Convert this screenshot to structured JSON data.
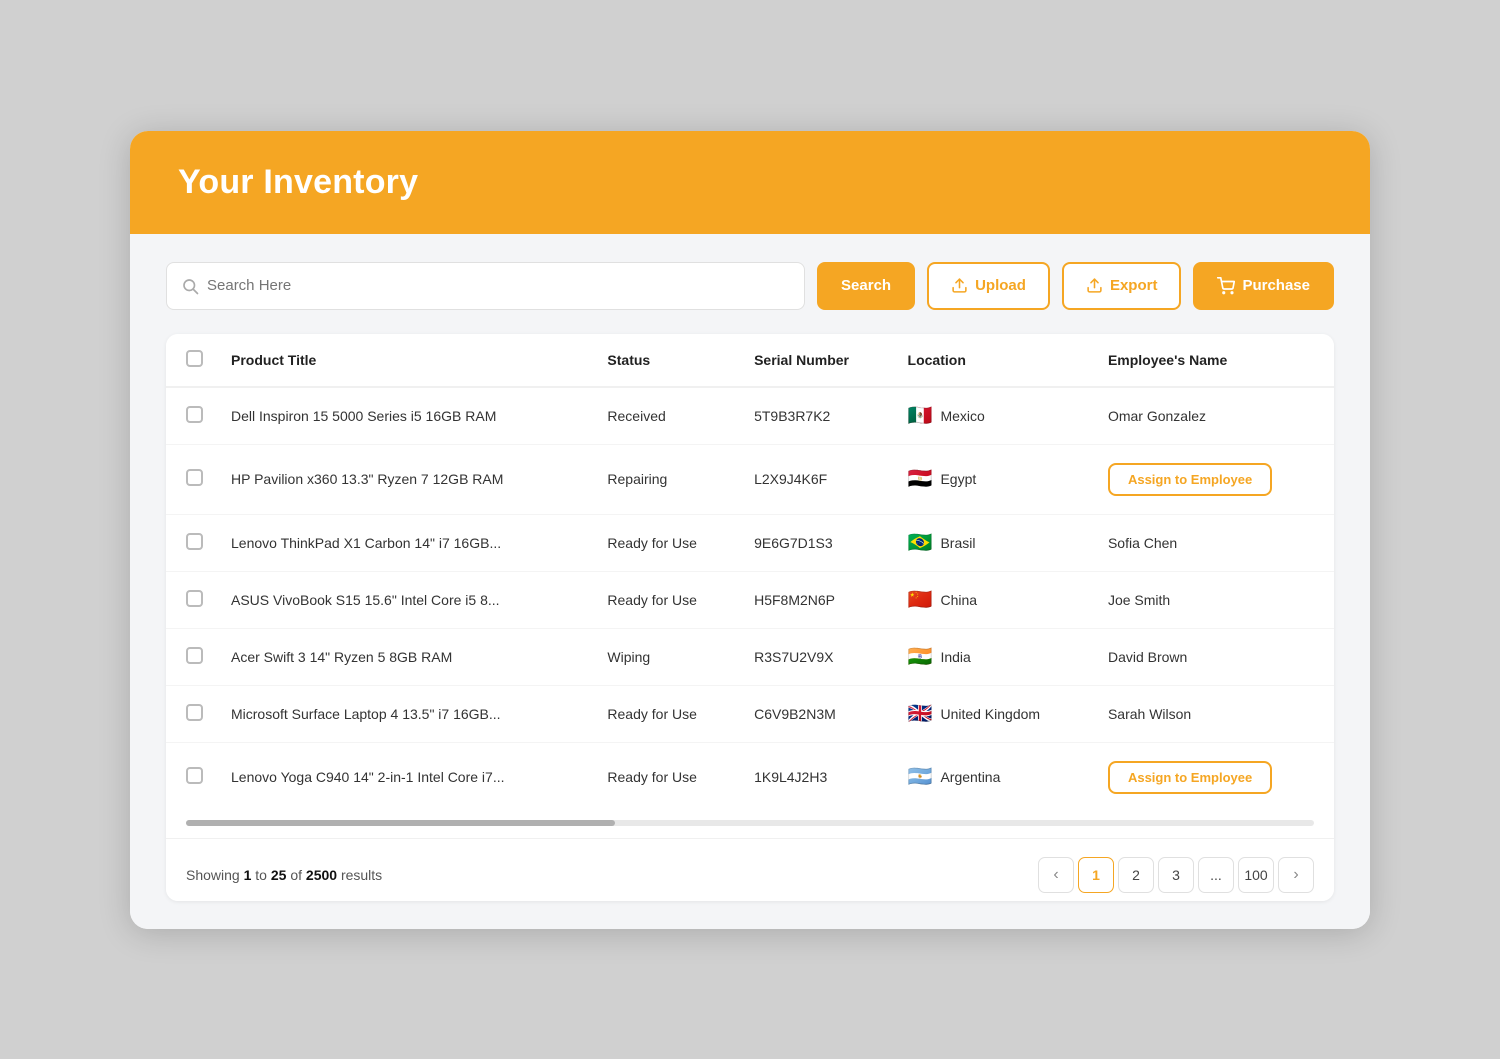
{
  "header": {
    "title": "Your Inventory"
  },
  "toolbar": {
    "search_placeholder": "Search Here",
    "search_label": "Search",
    "upload_label": "Upload",
    "export_label": "Export",
    "purchase_label": "Purchase"
  },
  "table": {
    "columns": [
      "Product Title",
      "Status",
      "Serial Number",
      "Location",
      "Employee's Name"
    ],
    "rows": [
      {
        "product": "Dell Inspiron 15 5000 Series i5 16GB RAM",
        "status": "Received",
        "serial": "5T9B3R7K2",
        "flag": "🇲🇽",
        "location": "Mexico",
        "employee": "Omar Gonzalez",
        "assign": false
      },
      {
        "product": "HP Pavilion x360 13.3\" Ryzen 7 12GB RAM",
        "status": "Repairing",
        "serial": "L2X9J4K6F",
        "flag": "🇪🇬",
        "location": "Egypt",
        "employee": "",
        "assign": true
      },
      {
        "product": "Lenovo ThinkPad X1 Carbon 14\" i7 16GB...",
        "status": "Ready for Use",
        "serial": "9E6G7D1S3",
        "flag": "🇧🇷",
        "location": "Brasil",
        "employee": "Sofia Chen",
        "assign": false
      },
      {
        "product": "ASUS VivoBook S15 15.6\" Intel Core i5 8...",
        "status": "Ready for Use",
        "serial": "H5F8M2N6P",
        "flag": "🇨🇳",
        "location": "China",
        "employee": "Joe Smith",
        "assign": false
      },
      {
        "product": "Acer Swift 3 14\" Ryzen 5 8GB RAM",
        "status": "Wiping",
        "serial": "R3S7U2V9X",
        "flag": "🇮🇳",
        "location": "India",
        "employee": "David Brown",
        "assign": false
      },
      {
        "product": "Microsoft Surface Laptop 4 13.5\" i7 16GB...",
        "status": "Ready for Use",
        "serial": "C6V9B2N3M",
        "flag": "🇬🇧",
        "location": "United Kingdom",
        "employee": "Sarah Wilson",
        "assign": false
      },
      {
        "product": "Lenovo Yoga C940 14\" 2-in-1 Intel Core i7...",
        "status": "Ready for Use",
        "serial": "1K9L4J2H3",
        "flag": "🇦🇷",
        "location": "Argentina",
        "employee": "",
        "assign": true
      }
    ]
  },
  "footer": {
    "showing_prefix": "Showing ",
    "showing_from": "1",
    "showing_to": "25",
    "showing_total": "2500",
    "showing_suffix": " results",
    "pages": [
      "1",
      "2",
      "3",
      "...",
      "100"
    ],
    "assign_btn_label": "Assign to Employee"
  },
  "icons": {
    "search": "🔍",
    "upload": "📤",
    "export": "📤",
    "purchase": "🛒",
    "prev": "‹",
    "next": "›"
  }
}
